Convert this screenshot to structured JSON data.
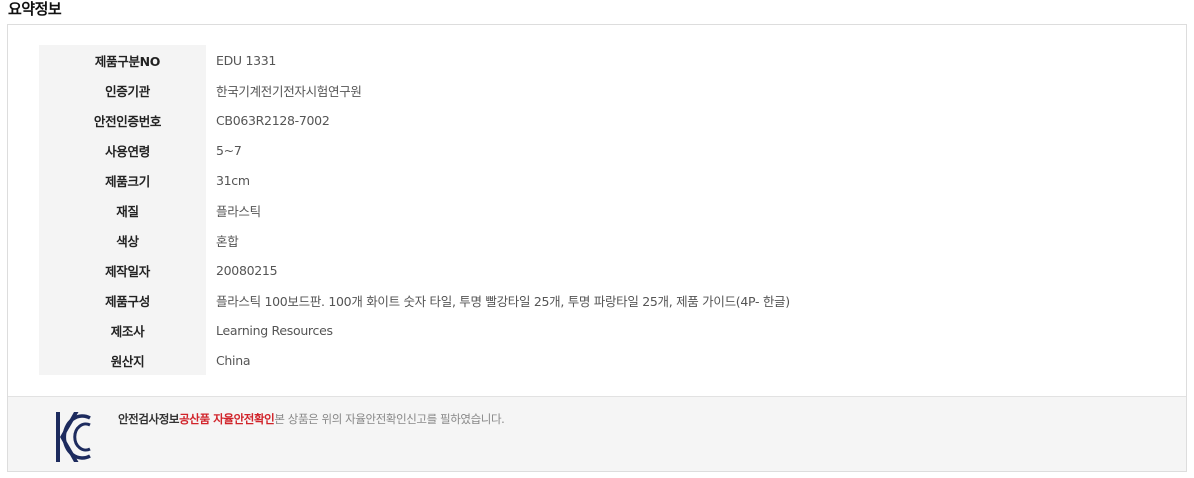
{
  "section": {
    "title": "요약정보"
  },
  "info_rows": [
    {
      "label": "제품구분NO",
      "value": "EDU 1331"
    },
    {
      "label": "인증기관",
      "value": "한국기계전기전자시험연구원"
    },
    {
      "label": "안전인증번호",
      "value": "CB063R2128-7002"
    },
    {
      "label": "사용연령",
      "value": "5~7"
    },
    {
      "label": "제품크기",
      "value": "31cm"
    },
    {
      "label": "재질",
      "value": "플라스틱"
    },
    {
      "label": "색상",
      "value": "혼합"
    },
    {
      "label": "제작일자",
      "value": "20080215"
    },
    {
      "label": "제품구성",
      "value": "플라스틱 100보드판. 100개 화이트 숫자 타일, 투명 빨강타일 25개, 투명 파랑타일 25개, 제품 가이드(4P- 한글)"
    },
    {
      "label": "제조사",
      "value": "Learning Resources"
    },
    {
      "label": "원산지",
      "value": "China"
    }
  ],
  "kc_notice": {
    "label": "안전검사정보",
    "highlight": "공산품 자율안전확인",
    "description": "본 상품은 위의 자율안전확인신고를 필하였습니다.",
    "logo_icon": "kc-mark-icon",
    "logo_color": "#1d2b5e",
    "highlight_color": "#d1232a"
  }
}
